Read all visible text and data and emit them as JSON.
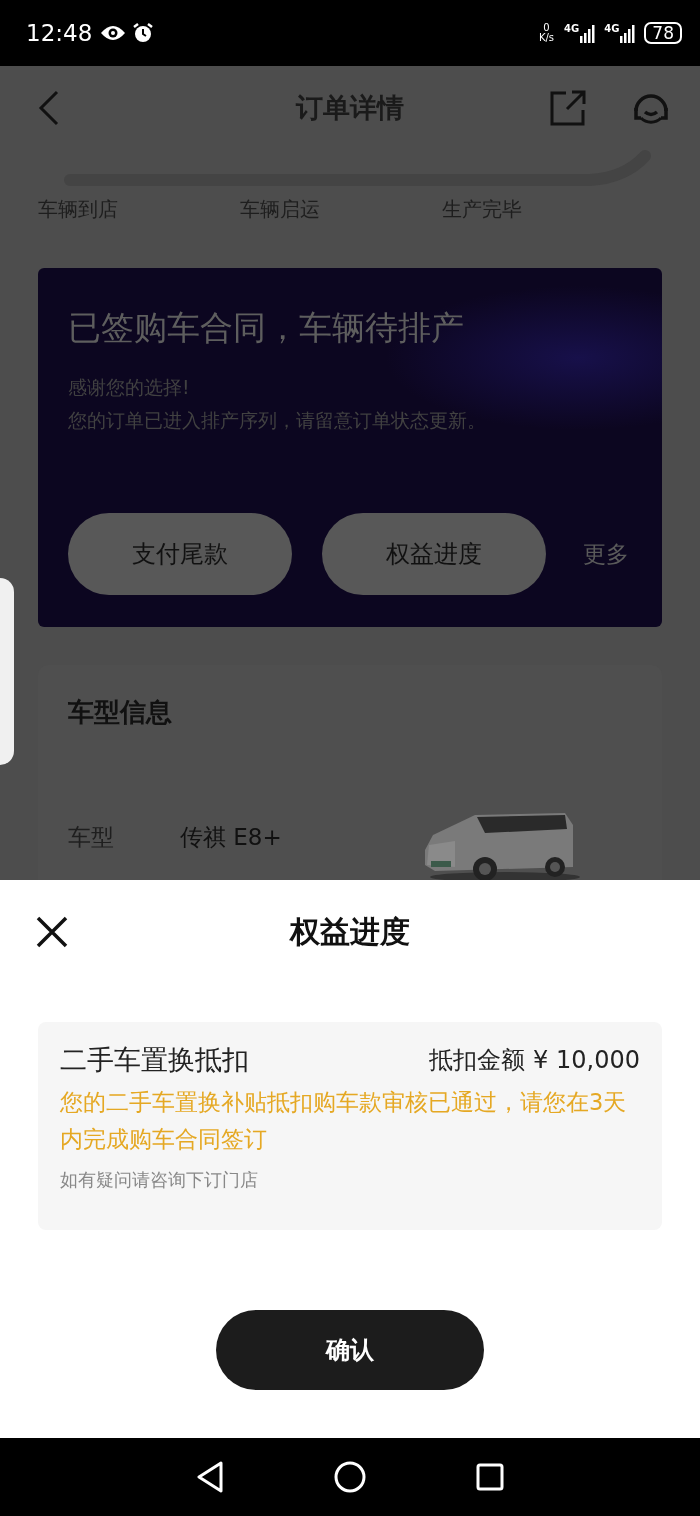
{
  "status_bar": {
    "time": "12:48",
    "net_speed": "0",
    "net_unit": "K/s",
    "networks": [
      "4G",
      "4G"
    ],
    "battery": "78"
  },
  "header": {
    "title": "订单详情"
  },
  "progress": {
    "steps": [
      "车辆到店",
      "车辆启运",
      "生产完毕"
    ]
  },
  "status_card": {
    "title": "已签购车合同，车辆待排产",
    "lines": [
      "感谢您的选择!",
      "您的订单已进入排产序列，请留意订单状态更新。"
    ],
    "buttons": [
      "支付尾款",
      "权益进度"
    ],
    "more": "更多"
  },
  "vehicle_card": {
    "title": "车型信息",
    "fields": [
      {
        "label": "车型",
        "value": "传祺 E8+"
      }
    ]
  },
  "sheet": {
    "title": "权益进度",
    "benefits": [
      {
        "name": "二手车置换抵扣",
        "amount": "抵扣金额 ¥ 10,000",
        "message": "您的二手车置换补贴抵扣购车款审核已通过，请您在3天内完成购车合同签订",
        "note": "如有疑问请咨询下订门店"
      }
    ],
    "confirm": "确认"
  }
}
